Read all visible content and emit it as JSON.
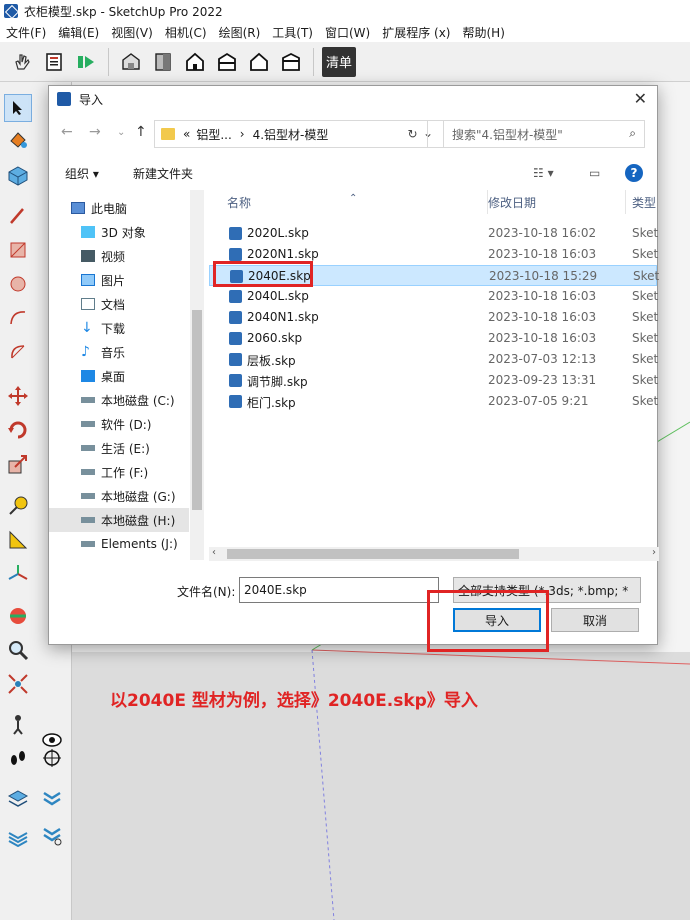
{
  "window": {
    "title": "衣柜模型.skp - SketchUp Pro 2022"
  },
  "menu": [
    "文件(F)",
    "编辑(E)",
    "视图(V)",
    "相机(C)",
    "绘图(R)",
    "工具(T)",
    "窗口(W)",
    "扩展程序 (x)",
    "帮助(H)"
  ],
  "toolbar": {
    "clean_label": "清单"
  },
  "dialog": {
    "title": "导入",
    "breadcrumb": [
      "«",
      "铝型...",
      "›",
      "4.铝型材-模型"
    ],
    "search_placeholder": "搜索\"4.铝型材-模型\"",
    "organize_label": "组织",
    "new_folder_label": "新建文件夹",
    "tree": [
      {
        "label": "此电脑",
        "icon": "pc-icon"
      },
      {
        "label": "3D 对象",
        "icon": "cube-icon"
      },
      {
        "label": "视频",
        "icon": "video-icon"
      },
      {
        "label": "图片",
        "icon": "picture-icon"
      },
      {
        "label": "文档",
        "icon": "document-icon"
      },
      {
        "label": "下载",
        "icon": "download-icon"
      },
      {
        "label": "音乐",
        "icon": "music-icon"
      },
      {
        "label": "桌面",
        "icon": "desktop-icon"
      },
      {
        "label": "本地磁盘 (C:)",
        "icon": "drive-icon"
      },
      {
        "label": "软件 (D:)",
        "icon": "drive-icon"
      },
      {
        "label": "生活 (E:)",
        "icon": "drive-icon"
      },
      {
        "label": "工作 (F:)",
        "icon": "drive-icon"
      },
      {
        "label": "本地磁盘 (G:)",
        "icon": "drive-icon"
      },
      {
        "label": "本地磁盘 (H:)",
        "icon": "drive-icon"
      },
      {
        "label": "Elements (J:)",
        "icon": "drive-icon"
      }
    ],
    "columns": {
      "name": "名称",
      "date": "修改日期",
      "type": "类型"
    },
    "files": [
      {
        "name": "2020L.skp",
        "date": "2023-10-18 16:02",
        "type": "Sket"
      },
      {
        "name": "2020N1.skp",
        "date": "2023-10-18 16:03",
        "type": "Sket"
      },
      {
        "name": "2040E.skp",
        "date": "2023-10-18 15:29",
        "type": "Sket"
      },
      {
        "name": "2040L.skp",
        "date": "2023-10-18 16:03",
        "type": "Sket"
      },
      {
        "name": "2040N1.skp",
        "date": "2023-10-18 16:03",
        "type": "Sket"
      },
      {
        "name": "2060.skp",
        "date": "2023-10-18 16:03",
        "type": "Sket"
      },
      {
        "name": "层板.skp",
        "date": "2023-07-03 12:13",
        "type": "Sket"
      },
      {
        "name": "调节脚.skp",
        "date": "2023-09-23 13:31",
        "type": "Sket"
      },
      {
        "name": "柜门.skp",
        "date": "2023-07-05 9:21",
        "type": "Sket"
      }
    ],
    "filename_label": "文件名(N):",
    "filename_value": "2040E.skp",
    "filetype_value": "全部支持类型 (*.3ds; *.bmp; *",
    "import_button": "导入",
    "cancel_button": "取消"
  },
  "annotation": "以2040E 型材为例，选择》2040E.skp》导入",
  "colors": {
    "highlight": "#e02424",
    "selection": "#cce8ff",
    "accent": "#0078d7"
  }
}
